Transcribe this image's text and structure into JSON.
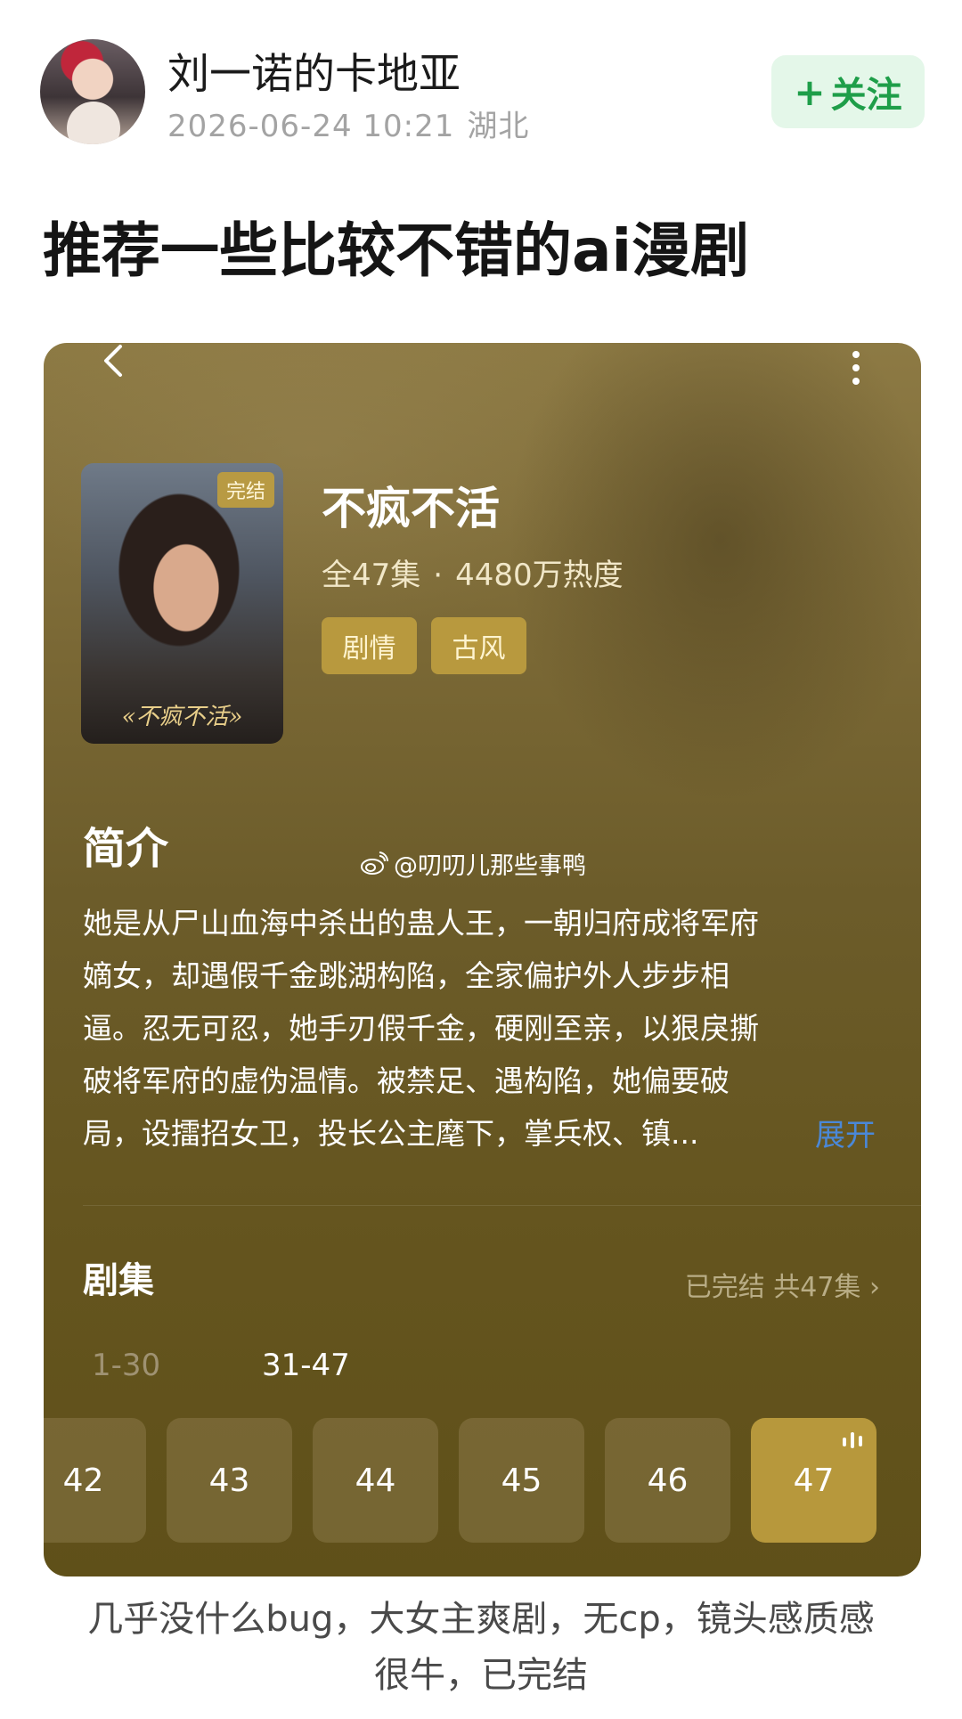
{
  "post": {
    "username": "刘一诺的卡地亚",
    "datetime": "2026-06-24 10:21",
    "location": "湖北",
    "follow_label": "关注",
    "follow_plus": "+",
    "title": "推荐一些比较不错的ai漫剧",
    "caption_line1": "几乎没什么bug，大女主爽剧，无cp，镜头感质感",
    "caption_line2": "很牛，已完结"
  },
  "drama": {
    "cover_badge": "完结",
    "cover_title": "«不疯不活»",
    "title": "不疯不活",
    "episodes_count": "全47集",
    "stats_dot": "·",
    "heat": "4480万热度",
    "tags": [
      "剧情",
      "古风"
    ],
    "intro_heading": "简介",
    "watermark": "@叨叨儿那些事鸭",
    "intro_lines": [
      "她是从尸山血海中杀出的蛊人王，一朝归府成将军府",
      "嫡女，却遇假千金跳湖构陷，全家偏护外人步步相",
      "逼。忍无可忍，她手刃假千金，硬刚至亲，以狠戾撕",
      "破将军府的虚伪温情。被禁足、遇构陷，她偏要破",
      "局，设擂招女卫，投长公主麾下，掌兵权、镇..."
    ],
    "expand_label": "展开",
    "episodes_heading": "剧集",
    "episodes_summary": "已完结 共47集 ›",
    "ranges": [
      "1-30",
      "31-47"
    ],
    "episode_buttons": [
      "42",
      "43",
      "44",
      "45",
      "46",
      "47"
    ],
    "active_episode": "47"
  },
  "colors": {
    "follow_green": "#1e9e49",
    "card_gold": "#b8993e",
    "expand_blue": "#4a88d8"
  },
  "icons": {
    "back": "chevron-left-icon",
    "more": "more-vertical-icon",
    "weibo": "weibo-icon",
    "playing": "audio-bars-icon"
  }
}
